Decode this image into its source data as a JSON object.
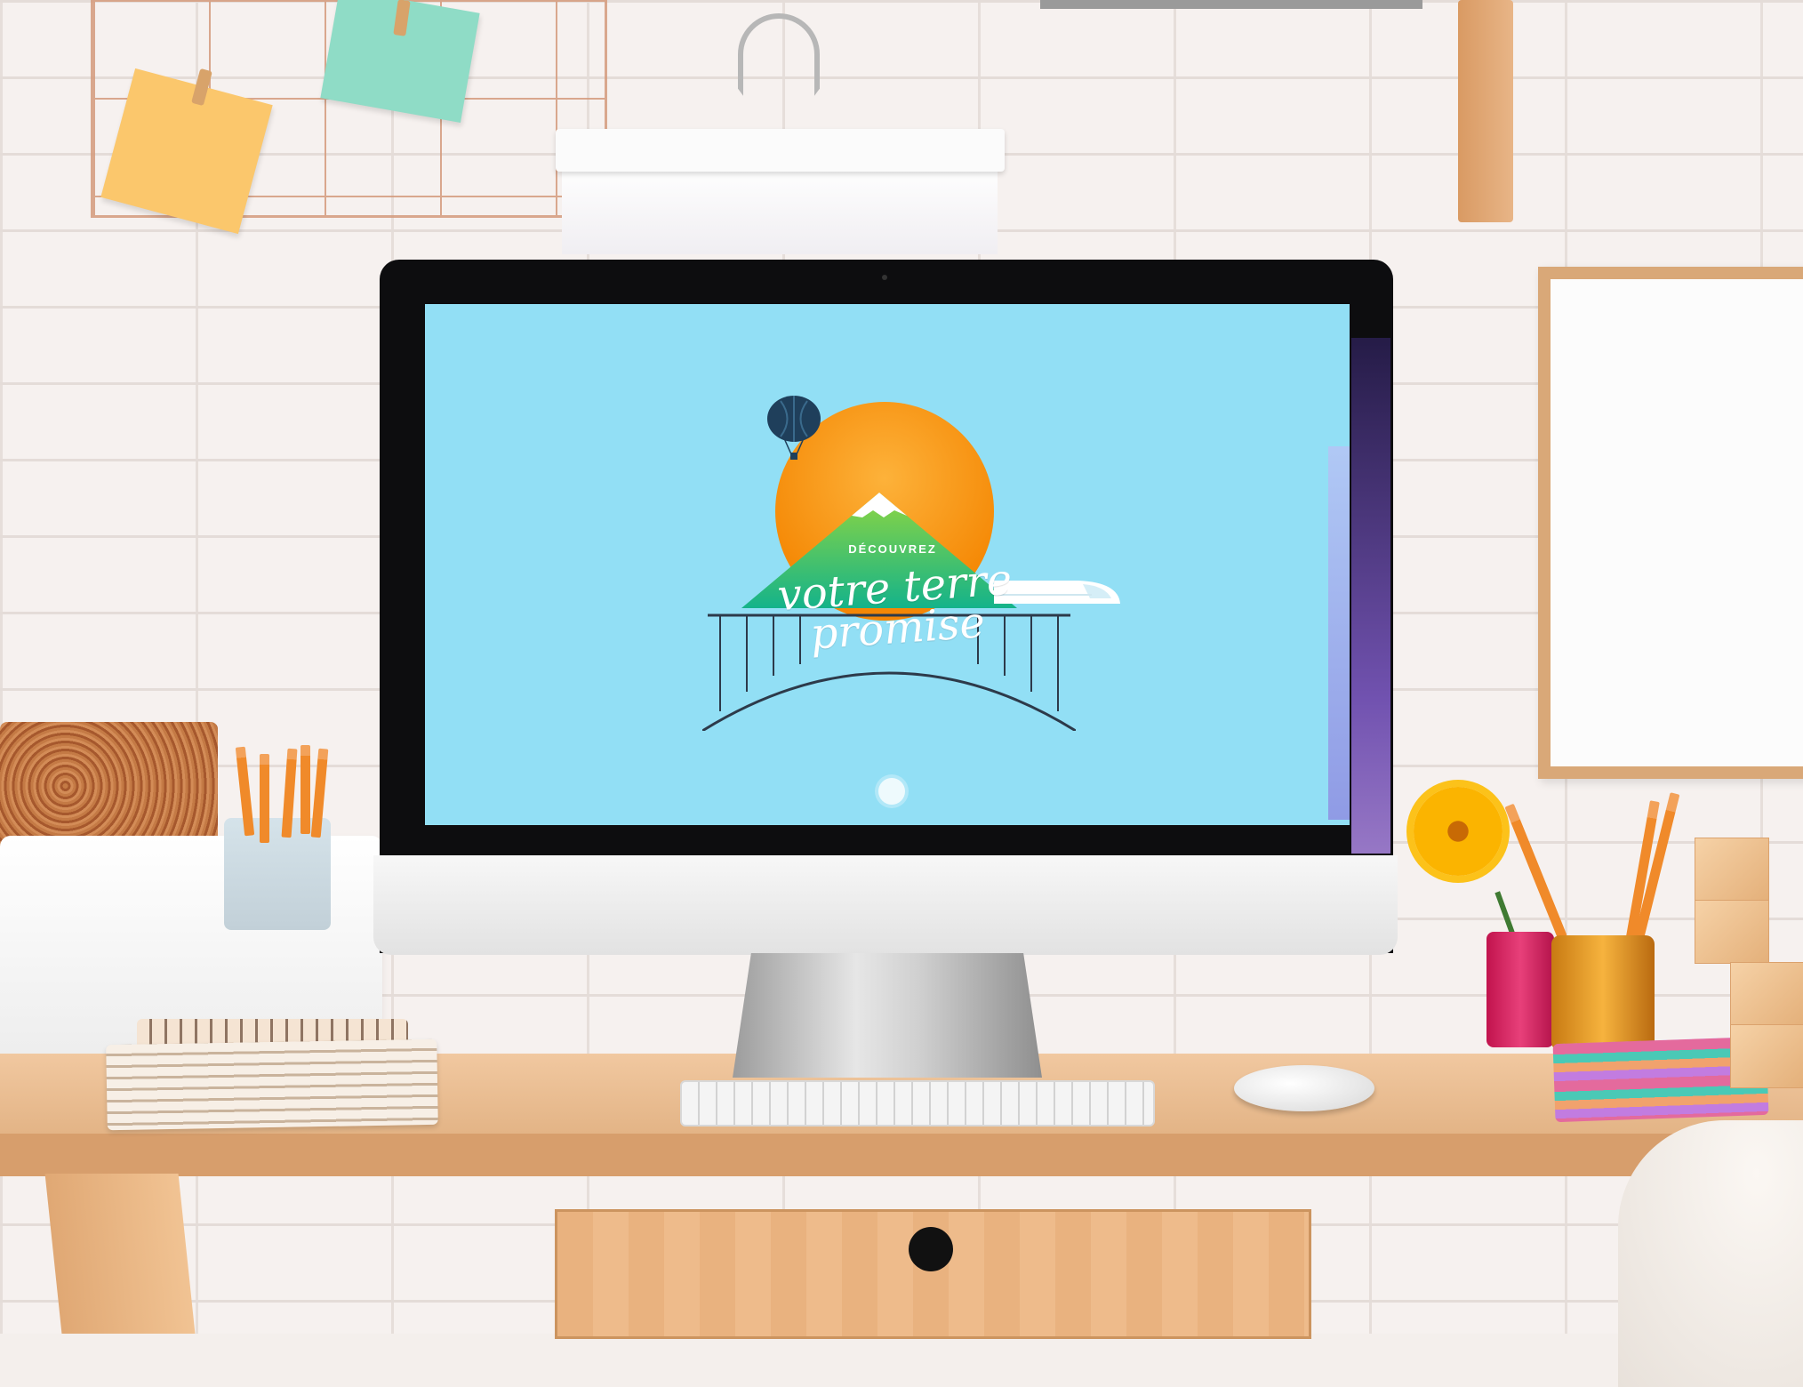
{
  "screen": {
    "subtitle": "DÉCOUVREZ",
    "title_line1": "votre terre",
    "title_line2": "promise"
  },
  "colors": {
    "screen_bg": "#92dff5",
    "sun": "#f58a07",
    "mountain_green": "#2fc48d",
    "balloon": "#1f3f5b",
    "wall": "#f6f1ef",
    "desk": "#e3b486"
  },
  "icons": [
    "hot-air-balloon-icon",
    "mountain-icon",
    "train-icon",
    "bridge-icon",
    "scroll-indicator-dot"
  ]
}
